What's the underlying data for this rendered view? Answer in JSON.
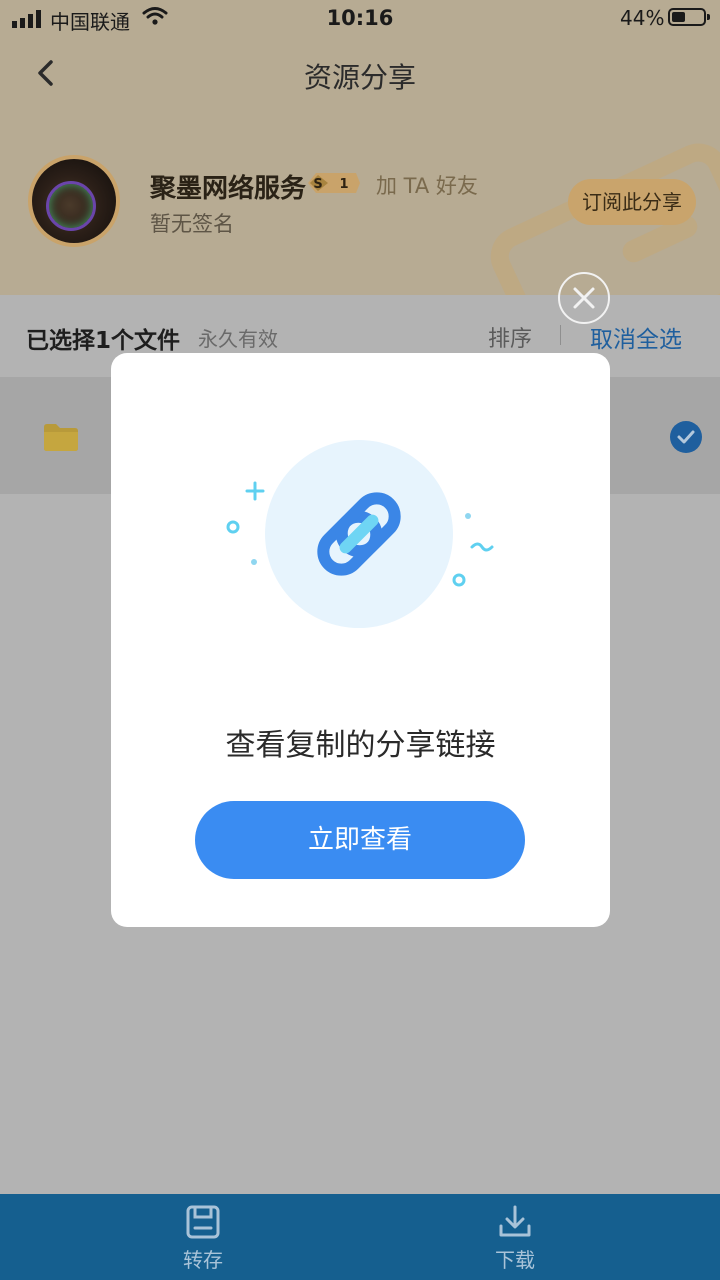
{
  "status": {
    "carrier": "中国联通",
    "time": "10:16",
    "battery": "44%",
    "battery_level": 0.44,
    "signal_bars": 4
  },
  "header": {
    "title": "资源分享",
    "back_icon": "chevron-left-icon"
  },
  "profile": {
    "name": "聚墨网络服务",
    "level_badge": {
      "letter": "S",
      "level": "1"
    },
    "add_friend": "加 TA 好友",
    "signature": "暂无签名",
    "subscribe_label": "订阅此分享"
  },
  "selection": {
    "count_text": "已选择1个文件",
    "validity": "永久有效",
    "sort_label": "排序",
    "cancel_all_label": "取消全选"
  },
  "file_list": [
    {
      "icon": "folder-icon",
      "selected": true
    }
  ],
  "modal": {
    "icon": "link-icon",
    "title": "查看复制的分享链接",
    "button_label": "立即查看",
    "close_icon": "close-icon"
  },
  "bottom_bar": {
    "tabs": [
      {
        "label": "转存",
        "icon": "save-icon"
      },
      {
        "label": "下载",
        "icon": "download-icon"
      }
    ]
  },
  "colors": {
    "accent": "#3a8cf2",
    "bottom_bar": "#155f8f",
    "header_bg": "#b7ab93",
    "overlay_bg": "#b3b3b3"
  }
}
